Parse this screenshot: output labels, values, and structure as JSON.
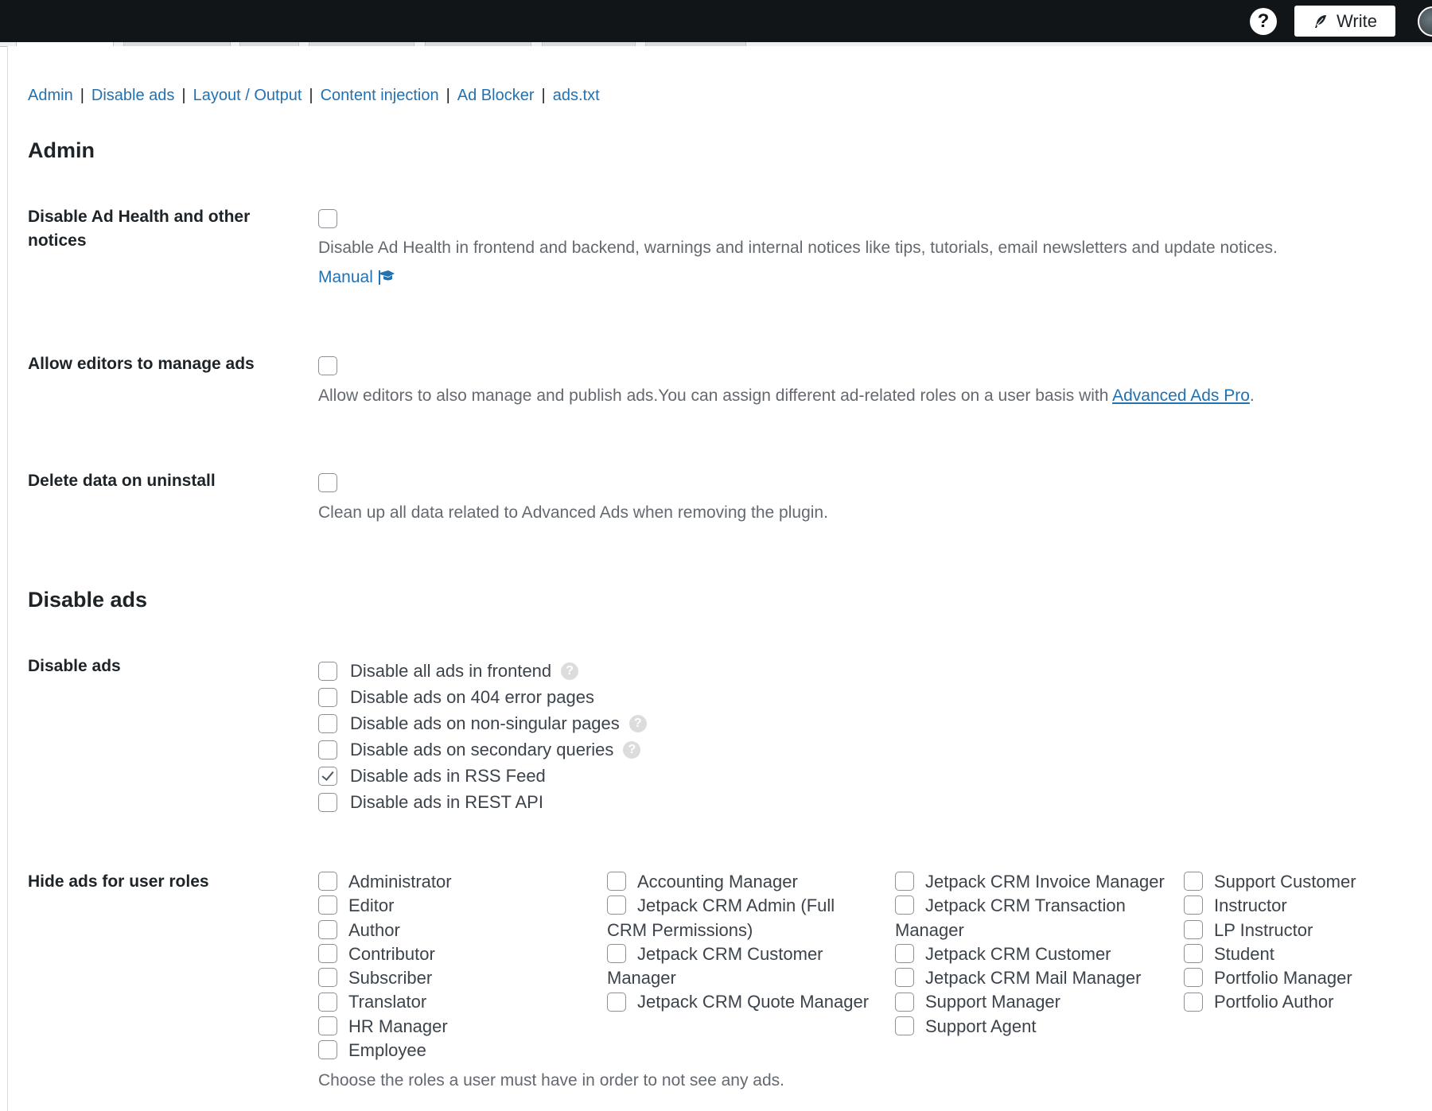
{
  "topbar": {
    "help_icon_label": "?",
    "write_label": "Write"
  },
  "subnav": {
    "links": [
      "Admin",
      "Disable ads",
      "Layout / Output",
      "Content injection",
      "Ad Blocker",
      "ads.txt"
    ],
    "separator": "|"
  },
  "admin": {
    "title": "Admin",
    "rows": [
      {
        "label": "Disable Ad Health and other notices",
        "checked": false,
        "description": "Disable Ad Health in frontend and backend, warnings and internal notices like tips, tutorials, email newsletters and update notices.",
        "link": "Manual"
      },
      {
        "label": "Allow editors to manage ads",
        "checked": false,
        "description": "Allow editors to also manage and publish ads.You can assign different ad-related roles on a user basis with ",
        "link": "Advanced Ads Pro",
        "suffix": "."
      },
      {
        "label": "Delete data on uninstall",
        "checked": false,
        "description": "Clean up all data related to Advanced Ads when removing the plugin."
      }
    ]
  },
  "disable_ads": {
    "title": "Disable ads",
    "label": "Disable ads",
    "options": [
      {
        "label": "Disable all ads in frontend",
        "checked": false,
        "help": true
      },
      {
        "label": "Disable ads on 404 error pages",
        "checked": false,
        "help": false
      },
      {
        "label": "Disable ads on non-singular pages",
        "checked": false,
        "help": true
      },
      {
        "label": "Disable ads on secondary queries",
        "checked": false,
        "help": true
      },
      {
        "label": "Disable ads in RSS Feed",
        "checked": true,
        "help": false
      },
      {
        "label": "Disable ads in REST API",
        "checked": false,
        "help": false
      }
    ],
    "help_glyph": "?"
  },
  "hide_roles": {
    "label": "Hide ads for user roles",
    "columns": [
      [
        "Administrator",
        "Editor",
        "Author",
        "Contributor",
        "Subscriber",
        "Translator",
        "HR Manager",
        "Employee"
      ],
      [
        "Accounting Manager",
        "Jetpack CRM Admin (Full CRM Permissions)",
        "Jetpack CRM Customer Manager",
        "Jetpack CRM Quote Manager"
      ],
      [
        "Jetpack CRM Invoice Manager",
        "Jetpack CRM Transaction Manager",
        "Jetpack CRM Customer",
        "Jetpack CRM Mail Manager",
        "Support Manager",
        "Support Agent"
      ],
      [
        "Support Customer",
        "Instructor",
        "LP Instructor",
        "Student",
        "Portfolio Manager",
        "Portfolio Author"
      ]
    ],
    "description": "Choose the roles a user must have in order to not see any ads."
  }
}
